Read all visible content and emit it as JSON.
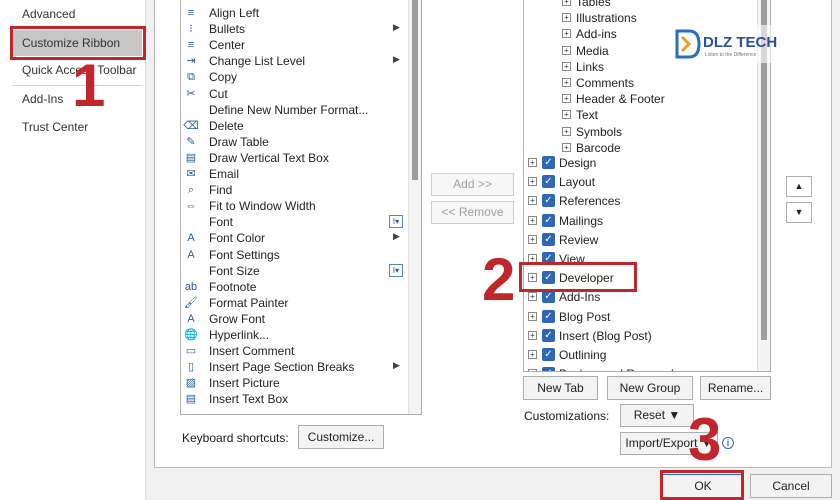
{
  "nav": {
    "items": [
      "Advanced",
      "Customize Ribbon",
      "Quick Access Toolbar",
      "Add-Ins",
      "Trust Center"
    ]
  },
  "commands": [
    {
      "label": "Align Left",
      "icon": "align-left-icon",
      "glyph": "≡"
    },
    {
      "label": "Bullets",
      "icon": "bullets-icon",
      "glyph": "⁝",
      "arrow": true
    },
    {
      "label": "Center",
      "icon": "align-center-icon",
      "glyph": "≡"
    },
    {
      "label": "Change List Level",
      "icon": "list-level-icon",
      "glyph": "⇥",
      "arrow": true
    },
    {
      "label": "Copy",
      "icon": "copy-icon",
      "glyph": "⧉"
    },
    {
      "label": "Cut",
      "icon": "cut-icon",
      "glyph": "✂"
    },
    {
      "label": "Define New Number Format...",
      "icon": "",
      "glyph": ""
    },
    {
      "label": "Delete",
      "icon": "delete-icon",
      "glyph": "⌫"
    },
    {
      "label": "Draw Table",
      "icon": "draw-table-icon",
      "glyph": "✎"
    },
    {
      "label": "Draw Vertical Text Box",
      "icon": "text-box-icon",
      "glyph": "▤"
    },
    {
      "label": "Email",
      "icon": "email-icon",
      "glyph": "✉"
    },
    {
      "label": "Find",
      "icon": "find-icon",
      "glyph": "⌕"
    },
    {
      "label": "Fit to Window Width",
      "icon": "fit-width-icon",
      "glyph": "⇔"
    },
    {
      "label": "Font",
      "icon": "",
      "glyph": "",
      "combo": true
    },
    {
      "label": "Font Color",
      "icon": "font-color-icon",
      "glyph": "A",
      "arrow": true
    },
    {
      "label": "Font Settings",
      "icon": "font-settings-icon",
      "glyph": "A"
    },
    {
      "label": "Font Size",
      "icon": "",
      "glyph": "",
      "combo": true
    },
    {
      "label": "Footnote",
      "icon": "footnote-icon",
      "glyph": "ab"
    },
    {
      "label": "Format Painter",
      "icon": "format-painter-icon",
      "glyph": "🖌"
    },
    {
      "label": "Grow Font",
      "icon": "grow-font-icon",
      "glyph": "A"
    },
    {
      "label": "Hyperlink...",
      "icon": "hyperlink-icon",
      "glyph": "🌐"
    },
    {
      "label": "Insert Comment",
      "icon": "comment-icon",
      "glyph": "▭"
    },
    {
      "label": "Insert Page  Section Breaks",
      "icon": "page-break-icon",
      "glyph": "▯",
      "arrow": true
    },
    {
      "label": "Insert Picture",
      "icon": "picture-icon",
      "glyph": "▨"
    },
    {
      "label": "Insert Text Box",
      "icon": "insert-text-box-icon",
      "glyph": "▤"
    }
  ],
  "buttons": {
    "add": "Add >>",
    "remove": "<< Remove",
    "new_tab": "New Tab",
    "new_group": "New Group",
    "rename": "Rename...",
    "reset": "Reset ▼",
    "import_export": "Import/Export ▼",
    "customize": "Customize...",
    "ok": "OK",
    "cancel": "Cancel",
    "move_up": "▲",
    "move_down": "▼"
  },
  "labels": {
    "keyboard_shortcuts": "Keyboard shortcuts:",
    "customizations": "Customizations:"
  },
  "tree": {
    "subgroups": [
      "Tables",
      "Illustrations",
      "Add-ins",
      "Media",
      "Links",
      "Comments",
      "Header & Footer",
      "Text",
      "Symbols",
      "Barcode"
    ],
    "tabs": [
      "Design",
      "Layout",
      "References",
      "Mailings",
      "Review",
      "View",
      "Developer",
      "Add-Ins",
      "Blog Post",
      "Insert (Blog Post)",
      "Outlining",
      "Background Removal"
    ]
  },
  "annotations": {
    "step1": "1",
    "step2": "2",
    "step3": "3"
  },
  "logo": {
    "text": "DLZ TECH",
    "tagline": "Listen to the Difference"
  },
  "colors": {
    "checkbox": "#2f66b5",
    "callout": "#c0262c",
    "nav_selected": "#c6c6c6"
  }
}
